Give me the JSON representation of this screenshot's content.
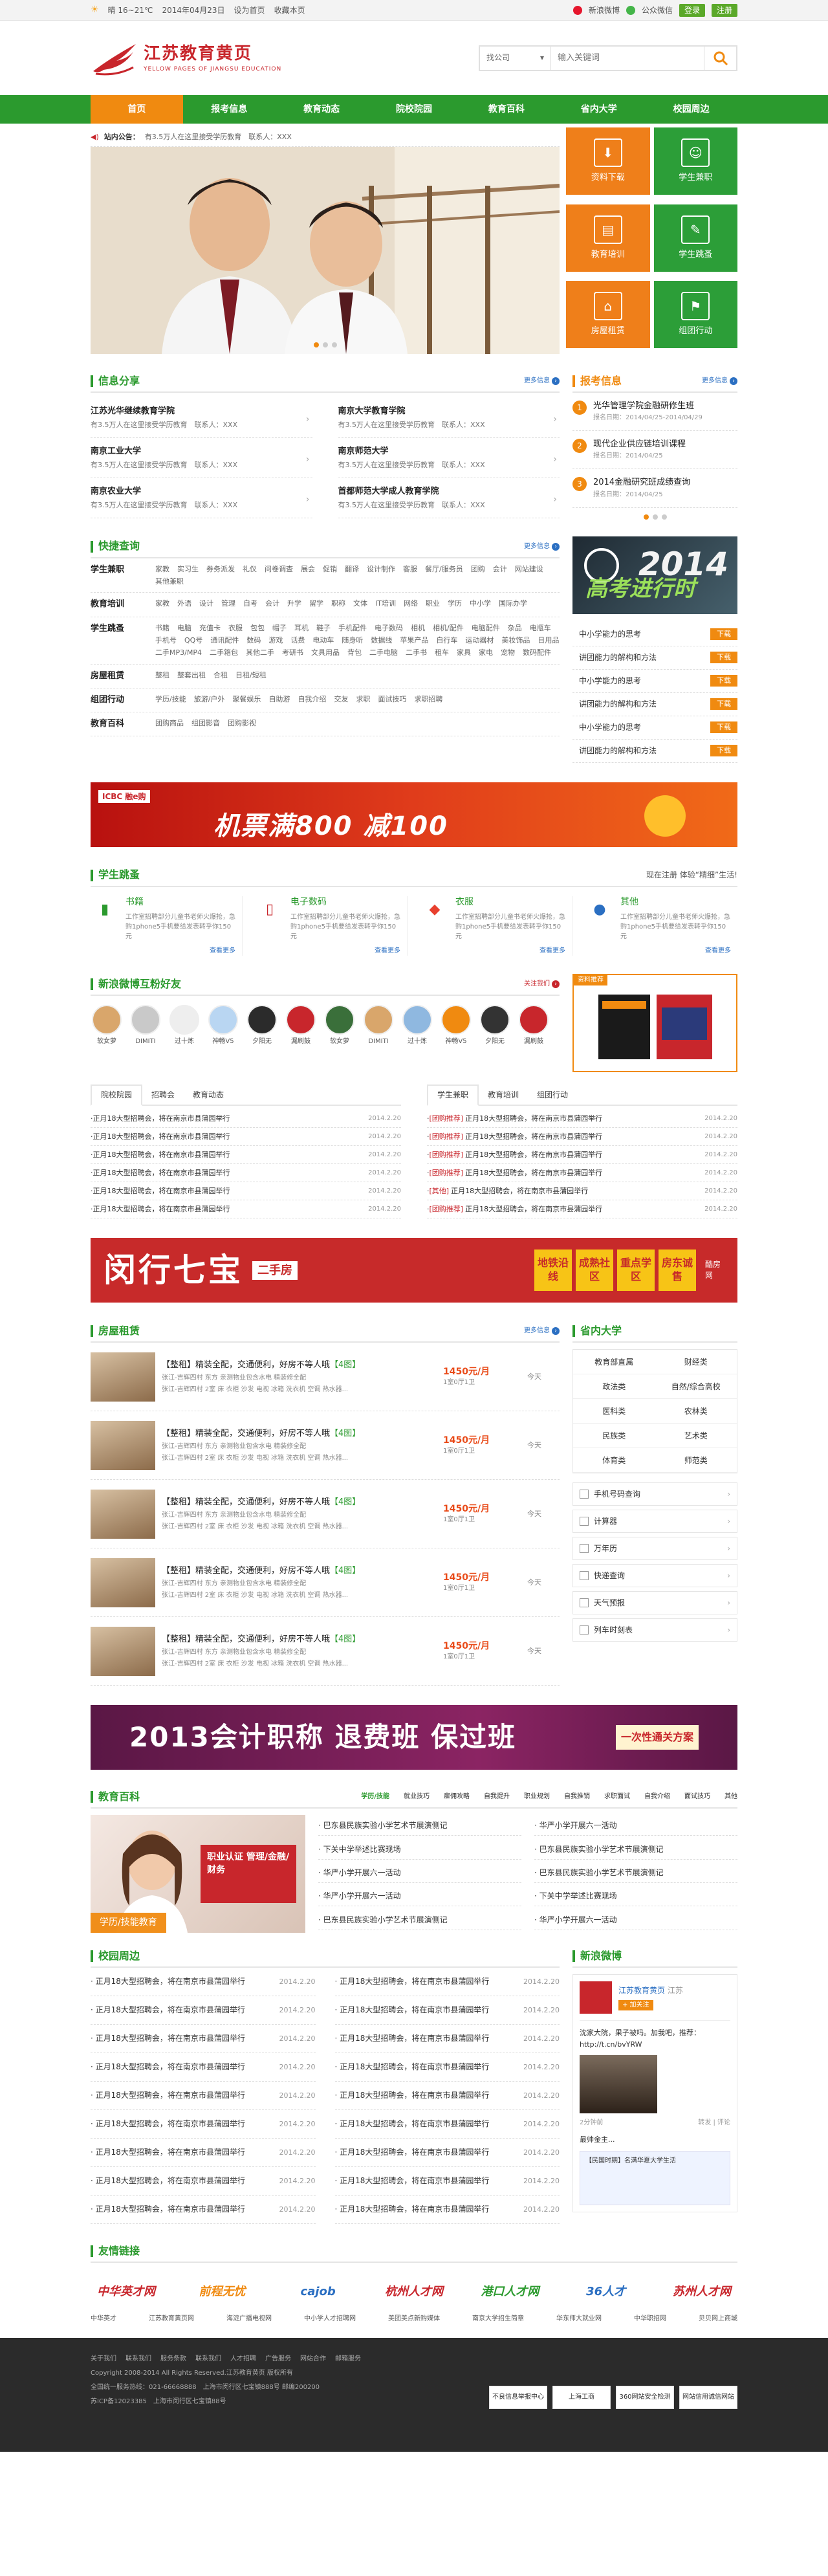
{
  "topbar": {
    "weather": "晴 16~21℃",
    "date": "2014年04月23日",
    "set_home": "设为首页",
    "favorite": "收藏本页",
    "weibo": "新浪微博",
    "wechat": "公众微信",
    "login": "登录",
    "register": "注册"
  },
  "logo": {
    "cn": "江苏教育黄页",
    "en": "YELLOW PAGES OF JIANGSU EDUCATION"
  },
  "search": {
    "category": "找公司",
    "placeholder": "输入关键词"
  },
  "nav": [
    "首页",
    "报考信息",
    "教育动态",
    "院校院园",
    "教育百科",
    "省内大学",
    "校园周边"
  ],
  "notice": {
    "label": "站内公告：",
    "text": "有3.5万人在这里接受学历教育　联系人：XXX"
  },
  "tiles": [
    {
      "label": "资料下载",
      "icon": "⬇"
    },
    {
      "label": "学生兼职",
      "icon": "☺"
    },
    {
      "label": "教育培训",
      "icon": "▤"
    },
    {
      "label": "学生跳蚤",
      "icon": "✎"
    },
    {
      "label": "房屋租赁",
      "icon": "⌂"
    },
    {
      "label": "组团行动",
      "icon": "⚑"
    }
  ],
  "info_share": {
    "title": "信息分享",
    "more": "更多信息",
    "items": [
      {
        "t": "江苏光华继续教育学院",
        "d": "有3.5万人在这里接受学历教育　联系人：XXX"
      },
      {
        "t": "南京大学教育学院",
        "d": "有3.5万人在这里接受学历教育　联系人：XXX"
      },
      {
        "t": "南京工业大学",
        "d": "有3.5万人在这里接受学历教育　联系人：XXX"
      },
      {
        "t": "南京师范大学",
        "d": "有3.5万人在这里接受学历教育　联系人：XXX"
      },
      {
        "t": "南京农业大学",
        "d": "有3.5万人在这里接受学历教育　联系人：XXX"
      },
      {
        "t": "首都师范大学成人教育学院",
        "d": "有3.5万人在这里接受学历教育　联系人：XXX"
      }
    ]
  },
  "exam_info": {
    "title": "报考信息",
    "more": "更多信息",
    "items": [
      {
        "n": "1",
        "t": "光华管理学院金融研修生班",
        "d": "报名日期：2014/04/25-2014/04/29"
      },
      {
        "n": "2",
        "t": "现代企业供应链培训课程",
        "d": "报名日期：2014/04/25"
      },
      {
        "n": "3",
        "t": "2014金融研究班成绩查询",
        "d": "报名日期：2014/04/25"
      }
    ]
  },
  "quick": {
    "title": "快捷查询",
    "more": "更多信息",
    "rows": [
      {
        "k": "学生兼职",
        "v": [
          "家教",
          "实习生",
          "券务派发",
          "礼仪",
          "问卷调查",
          "展会",
          "促销",
          "翻译",
          "设计制作",
          "客服",
          "餐厅/服务员",
          "团购",
          "会计",
          "网站建设",
          "其他兼职"
        ]
      },
      {
        "k": "教育培训",
        "v": [
          "家教",
          "外语",
          "设计",
          "管理",
          "自考",
          "会计",
          "升学",
          "留学",
          "职称",
          "文体",
          "IT培训",
          "网络",
          "职业",
          "学历",
          "中小学",
          "国际办学"
        ]
      },
      {
        "k": "学生跳蚤",
        "v": [
          "书籍",
          "电脑",
          "充值卡",
          "衣服",
          "包包",
          "帽子",
          "耳机",
          "鞋子",
          "手机配件",
          "电子数码",
          "相机",
          "相机/配件",
          "电脑配件",
          "杂品",
          "电瓶车",
          "手机号",
          "QQ号",
          "通讯配件",
          "数码",
          "游戏",
          "话费",
          "电动车",
          "随身听",
          "数据线",
          "苹果产品",
          "自行车",
          "运动器材",
          "美妆饰品",
          "日用品",
          "二手MP3/MP4",
          "二手箱包",
          "其他二手",
          "考研书",
          "文具用品",
          "背包",
          "二手电脑",
          "二手书",
          "租车",
          "家具",
          "家电",
          "宠物",
          "数码配件"
        ]
      },
      {
        "k": "房屋租赁",
        "v": [
          "整租",
          "整套出租",
          "合租",
          "日租/短租"
        ]
      },
      {
        "k": "组团行动",
        "v": [
          "学历/技能",
          "旅游/户外",
          "聚餐娱乐",
          "自助游",
          "自我介绍",
          "交友",
          "求职",
          "面试技巧",
          "求职招聘"
        ]
      },
      {
        "k": "教育百科",
        "v": [
          "团购商品",
          "组团影音",
          "团购影视"
        ]
      }
    ]
  },
  "side_banner": {
    "year": "2014",
    "slogan": "高考进行时"
  },
  "downloads": {
    "label": "下载",
    "items": [
      "中小学能力的思考",
      "讲团能力的解构和方法",
      "中小学能力的思考",
      "讲团能力的解构和方法",
      "中小学能力的思考",
      "讲团能力的解构和方法"
    ]
  },
  "ad_icbc": {
    "brand": "ICBC 融e购",
    "text": "机票满800 减100"
  },
  "flea": {
    "title": "学生跳蚤",
    "right": "现在注册 体验“精细”生活!",
    "items": [
      {
        "t": "书籍",
        "icon": "▮",
        "color": "#2b9a2e",
        "d": "工作室招聘部分儿童书老师火爆抢，急购1phone5手机要给发表转乎你150元",
        "m": "查看更多"
      },
      {
        "t": "电子数码",
        "icon": "▯",
        "color": "#c8262c",
        "d": "工作室招聘部分儿童书老师火爆抢，急购1phone5手机要给发表转乎你150元",
        "m": "查看更多"
      },
      {
        "t": "衣服",
        "icon": "◆",
        "color": "#e8402e",
        "d": "工作室招聘部分儿童书老师火爆抢，急购1phone5手机要给发表转乎你150元",
        "m": "查看更多"
      },
      {
        "t": "其他",
        "icon": "●",
        "color": "#2b6fc2",
        "d": "工作室招聘部分儿童书老师火爆抢，急购1phone5手机要给发表转乎你150元",
        "m": "查看更多"
      }
    ]
  },
  "weibo_friends": {
    "title": "新浪微博互粉好友",
    "follow": "关注我们",
    "names": [
      "软女萝",
      "DIMITI",
      "过十炼",
      "神畅V5",
      "夕阳无",
      "漏刷鼓",
      "软女萝",
      "DIMITI",
      "过十炼",
      "神畅V5",
      "夕阳无",
      "漏刷鼓"
    ],
    "ad_caption": "资料推荐"
  },
  "tabs_left": {
    "tabs": [
      "院校院园",
      "招聘会",
      "教育动态"
    ],
    "items": [
      {
        "t": "正月18大型招聘会，将在南京市县蒲园举行",
        "d": "2014.2.20"
      },
      {
        "t": "正月18大型招聘会，将在南京市县蒲园举行",
        "d": "2014.2.20"
      },
      {
        "t": "正月18大型招聘会，将在南京市县蒲园举行",
        "d": "2014.2.20"
      },
      {
        "t": "正月18大型招聘会，将在南京市县蒲园举行",
        "d": "2014.2.20"
      },
      {
        "t": "正月18大型招聘会，将在南京市县蒲园举行",
        "d": "2014.2.20"
      },
      {
        "t": "正月18大型招聘会，将在南京市县蒲园举行",
        "d": "2014.2.20"
      }
    ]
  },
  "tabs_right": {
    "tabs": [
      "学生兼职",
      "教育培训",
      "组团行动"
    ],
    "items": [
      {
        "b": "[团购推荐]",
        "t": "正月18大型招聘会，将在南京市县蒲园举行",
        "d": "2014.2.20"
      },
      {
        "b": "[团购推荐]",
        "t": "正月18大型招聘会，将在南京市县蒲园举行",
        "d": "2014.2.20"
      },
      {
        "b": "[团购推荐]",
        "t": "正月18大型招聘会，将在南京市县蒲园举行",
        "d": "2014.2.20"
      },
      {
        "b": "[团购推荐]",
        "t": "正月18大型招聘会，将在南京市县蒲园举行",
        "d": "2014.2.20"
      },
      {
        "b": "[其他]",
        "t": "正月18大型招聘会，将在南京市县蒲园举行",
        "d": "2014.2.20"
      },
      {
        "b": "[团购推荐]",
        "t": "正月18大型招聘会，将在南京市县蒲园举行",
        "d": "2014.2.20"
      }
    ]
  },
  "ad_house": {
    "title": "闵行七宝",
    "sub": "二手房",
    "tags": [
      "地铁沿线",
      "成熟社区",
      "重点学区",
      "房东诚售"
    ],
    "brand": "酷房网"
  },
  "rent": {
    "title": "房屋租赁",
    "more": "更多信息",
    "items": [
      {
        "t": "【整租】精装全配，交通便利，好房不等人哦",
        "g": "【4图】",
        "d": "张江-吉辉四村 东方 亲测物业包含水电 精装修全配",
        "d2": "张江-吉辉四村 2室 床 衣柜 沙发 电视 冰箱 洗衣机 空调 热水器...",
        "p": "1450元/月",
        "u": "1室0厅1卫",
        "w": "今天"
      },
      {
        "t": "【整租】精装全配，交通便利，好房不等人哦",
        "g": "【4图】",
        "d": "张江-吉辉四村 东方 亲测物业包含水电 精装修全配",
        "d2": "张江-吉辉四村 2室 床 衣柜 沙发 电视 冰箱 洗衣机 空调 热水器...",
        "p": "1450元/月",
        "u": "1室0厅1卫",
        "w": "今天"
      },
      {
        "t": "【整租】精装全配，交通便利，好房不等人哦",
        "g": "【4图】",
        "d": "张江-吉辉四村 东方 亲测物业包含水电 精装修全配",
        "d2": "张江-吉辉四村 2室 床 衣柜 沙发 电视 冰箱 洗衣机 空调 热水器...",
        "p": "1450元/月",
        "u": "1室0厅1卫",
        "w": "今天"
      },
      {
        "t": "【整租】精装全配，交通便利，好房不等人哦",
        "g": "【4图】",
        "d": "张江-吉辉四村 东方 亲测物业包含水电 精装修全配",
        "d2": "张江-吉辉四村 2室 床 衣柜 沙发 电视 冰箱 洗衣机 空调 热水器...",
        "p": "1450元/月",
        "u": "1室0厅1卫",
        "w": "今天"
      },
      {
        "t": "【整租】精装全配，交通便利，好房不等人哦",
        "g": "【4图】",
        "d": "张江-吉辉四村 东方 亲测物业包含水电 精装修全配",
        "d2": "张江-吉辉四村 2室 床 衣柜 沙发 电视 冰箱 洗衣机 空调 热水器...",
        "p": "1450元/月",
        "u": "1室0厅1卫",
        "w": "今天"
      }
    ]
  },
  "univ": {
    "title": "省内大学",
    "items": [
      "教育部直属",
      "财经类",
      "政法类",
      "自然/综合高校",
      "医科类",
      "农林类",
      "民族类",
      "艺术类",
      "体育类",
      "师范类"
    ]
  },
  "tools": [
    "手机号码查询",
    "计算器",
    "万年历",
    "快递查询",
    "天气预报",
    "列车时刻表"
  ],
  "ad_exam": {
    "title": "2013会计职称 退费班 保过班",
    "right": "一次性通关方案"
  },
  "baike": {
    "title": "教育百科",
    "tabs": [
      "学历/技能",
      "就业技巧",
      "雇佣攻略",
      "自我提升",
      "职业规划",
      "自我推销",
      "求职面试",
      "自我介绍",
      "面试技巧",
      "其他"
    ],
    "img_caption": "学历/技能教育",
    "img_box": "职业认证 管理/金融/财务",
    "items": [
      "巴东县民族实验小学艺术节展演侧记",
      "华严小学开展六一活动",
      "下关中学举述比赛现场",
      "巴东县民族实验小学艺术节展演侧记",
      "华严小学开展六一活动",
      "巴东县民族实验小学艺术节展演侧记",
      "华严小学开展六一活动",
      "下关中学举述比赛现场",
      "巴东县民族实验小学艺术节展演侧记",
      "华严小学开展六一活动"
    ]
  },
  "campus": {
    "title": "校园周边",
    "items": [
      {
        "t": "正月18大型招聘会，将在南京市县蒲园举行",
        "d": "2014.2.20"
      },
      {
        "t": "正月18大型招聘会，将在南京市县蒲园举行",
        "d": "2014.2.20"
      },
      {
        "t": "正月18大型招聘会，将在南京市县蒲园举行",
        "d": "2014.2.20"
      },
      {
        "t": "正月18大型招聘会，将在南京市县蒲园举行",
        "d": "2014.2.20"
      },
      {
        "t": "正月18大型招聘会，将在南京市县蒲园举行",
        "d": "2014.2.20"
      },
      {
        "t": "正月18大型招聘会，将在南京市县蒲园举行",
        "d": "2014.2.20"
      },
      {
        "t": "正月18大型招聘会，将在南京市县蒲园举行",
        "d": "2014.2.20"
      },
      {
        "t": "正月18大型招聘会，将在南京市县蒲园举行",
        "d": "2014.2.20"
      },
      {
        "t": "正月18大型招聘会，将在南京市县蒲园举行",
        "d": "2014.2.20"
      },
      {
        "t": "正月18大型招聘会，将在南京市县蒲园举行",
        "d": "2014.2.20"
      },
      {
        "t": "正月18大型招聘会，将在南京市县蒲园举行",
        "d": "2014.2.20"
      },
      {
        "t": "正月18大型招聘会，将在南京市县蒲园举行",
        "d": "2014.2.20"
      },
      {
        "t": "正月18大型招聘会，将在南京市县蒲园举行",
        "d": "2014.2.20"
      },
      {
        "t": "正月18大型招聘会，将在南京市县蒲园举行",
        "d": "2014.2.20"
      },
      {
        "t": "正月18大型招聘会，将在南京市县蒲园举行",
        "d": "2014.2.20"
      },
      {
        "t": "正月18大型招聘会，将在南京市县蒲园举行",
        "d": "2014.2.20"
      },
      {
        "t": "正月18大型招聘会，将在南京市县蒲园举行",
        "d": "2014.2.20"
      },
      {
        "t": "正月18大型招聘会，将在南京市县蒲园举行",
        "d": "2014.2.20"
      }
    ]
  },
  "sina": {
    "title": "新浪微博",
    "name": "江苏教育黄页",
    "loc": "江苏",
    "follow": "+ 加关注",
    "post": "沈家大院，果子被吗。加我吧，推荐：http://t.cn/bvYRW",
    "meta_l": "2分钟前",
    "meta_r": "转发 | 评论",
    "post2": "最帅金主...",
    "card": "【民国时期】名满华夏大学生活"
  },
  "links": {
    "title": "友情链接",
    "logos": [
      {
        "t": "中华英才网",
        "c": "#c8262c"
      },
      {
        "t": "前程无忧",
        "c": "#f08a10"
      },
      {
        "t": "cajob",
        "c": "#2b6fc2"
      },
      {
        "t": "杭州人才网",
        "c": "#c8262c"
      },
      {
        "t": "港口人才网",
        "c": "#2b9a2e"
      },
      {
        "t": "36人才",
        "c": "#2b6fc2"
      },
      {
        "t": "苏州人才网",
        "c": "#c8262c"
      }
    ],
    "text": [
      "中华英才",
      "江苏教育黄页网",
      "海淀广播电视网",
      "中小学人才招聘网",
      "美团美点新购媒体",
      "南京大学招生简章",
      "华东师大就业网",
      "中华职招网",
      "贝贝网上商城"
    ]
  },
  "footer": {
    "nav": [
      "关于我们",
      "联系我们",
      "服务条款",
      "联系我们",
      "人才招聘",
      "广告服务",
      "网站合作",
      "邮箱服务"
    ],
    "copyright": "Copyright 2008-2014 All Rights Reserved.江苏教育黄页 版权所有",
    "line2": "全国统一服务热线：021-66668888　上海市闵行区七宝镇888号 邮编200200",
    "line3": "苏ICP备12023385　上海市闵行区七宝镇88号",
    "badges": [
      "不良信息举报中心",
      "上海工商",
      "360网站安全检测",
      "网站信用诚信网站"
    ]
  }
}
